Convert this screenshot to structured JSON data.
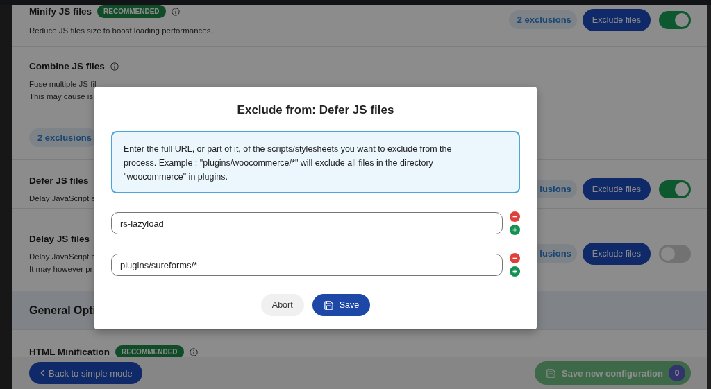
{
  "sections": [
    {
      "kind": "setting",
      "title": "Minify JS files",
      "badge": "RECOMMENDED",
      "info": true,
      "description": [
        "Reduce JS files size to boost loading performances."
      ],
      "exclusions": "2 exclusions",
      "exclude_button": "Exclude files",
      "toggle_on": true
    },
    {
      "kind": "setting",
      "title": "Combine JS files",
      "info": true,
      "description": [
        "Fuse multiple JS fil",
        "This may cause is"
      ],
      "exclusions_below": "2 exclusions"
    },
    {
      "kind": "setting",
      "title": "Defer JS files",
      "description": [
        "Delay JavaScript e"
      ],
      "exclusions": "lusions",
      "exclude_button": "Exclude files",
      "toggle_on": true
    },
    {
      "kind": "setting",
      "title": "Delay JS files",
      "description": [
        "Delay JavaScript e",
        "It may however pr"
      ],
      "exclusions": "lusions",
      "exclude_button": "Exclude files",
      "toggle_on": false
    },
    {
      "kind": "header",
      "title": "General Opti"
    },
    {
      "kind": "setting",
      "title": "HTML Minification",
      "badge": "RECOMMENDED",
      "info": true
    }
  ],
  "footer": {
    "back_button": "Back to simple mode",
    "save_button": {
      "label": "Save new configuration",
      "count": "0",
      "disabled": true
    }
  },
  "dialog": {
    "title": "Exclude from: Defer JS files",
    "hint": "Enter the full URL, or part of it, of the scripts/stylesheets you want to exclude from the process. Example : \"plugins/woocommerce/*\" will exclude all files in the directory \"woocommerce\" in plugins.",
    "entries": [
      {
        "value": "rs-lazyload"
      },
      {
        "value": "plugins/sureforms/*"
      }
    ],
    "abort": "Abort",
    "save": "Save"
  }
}
